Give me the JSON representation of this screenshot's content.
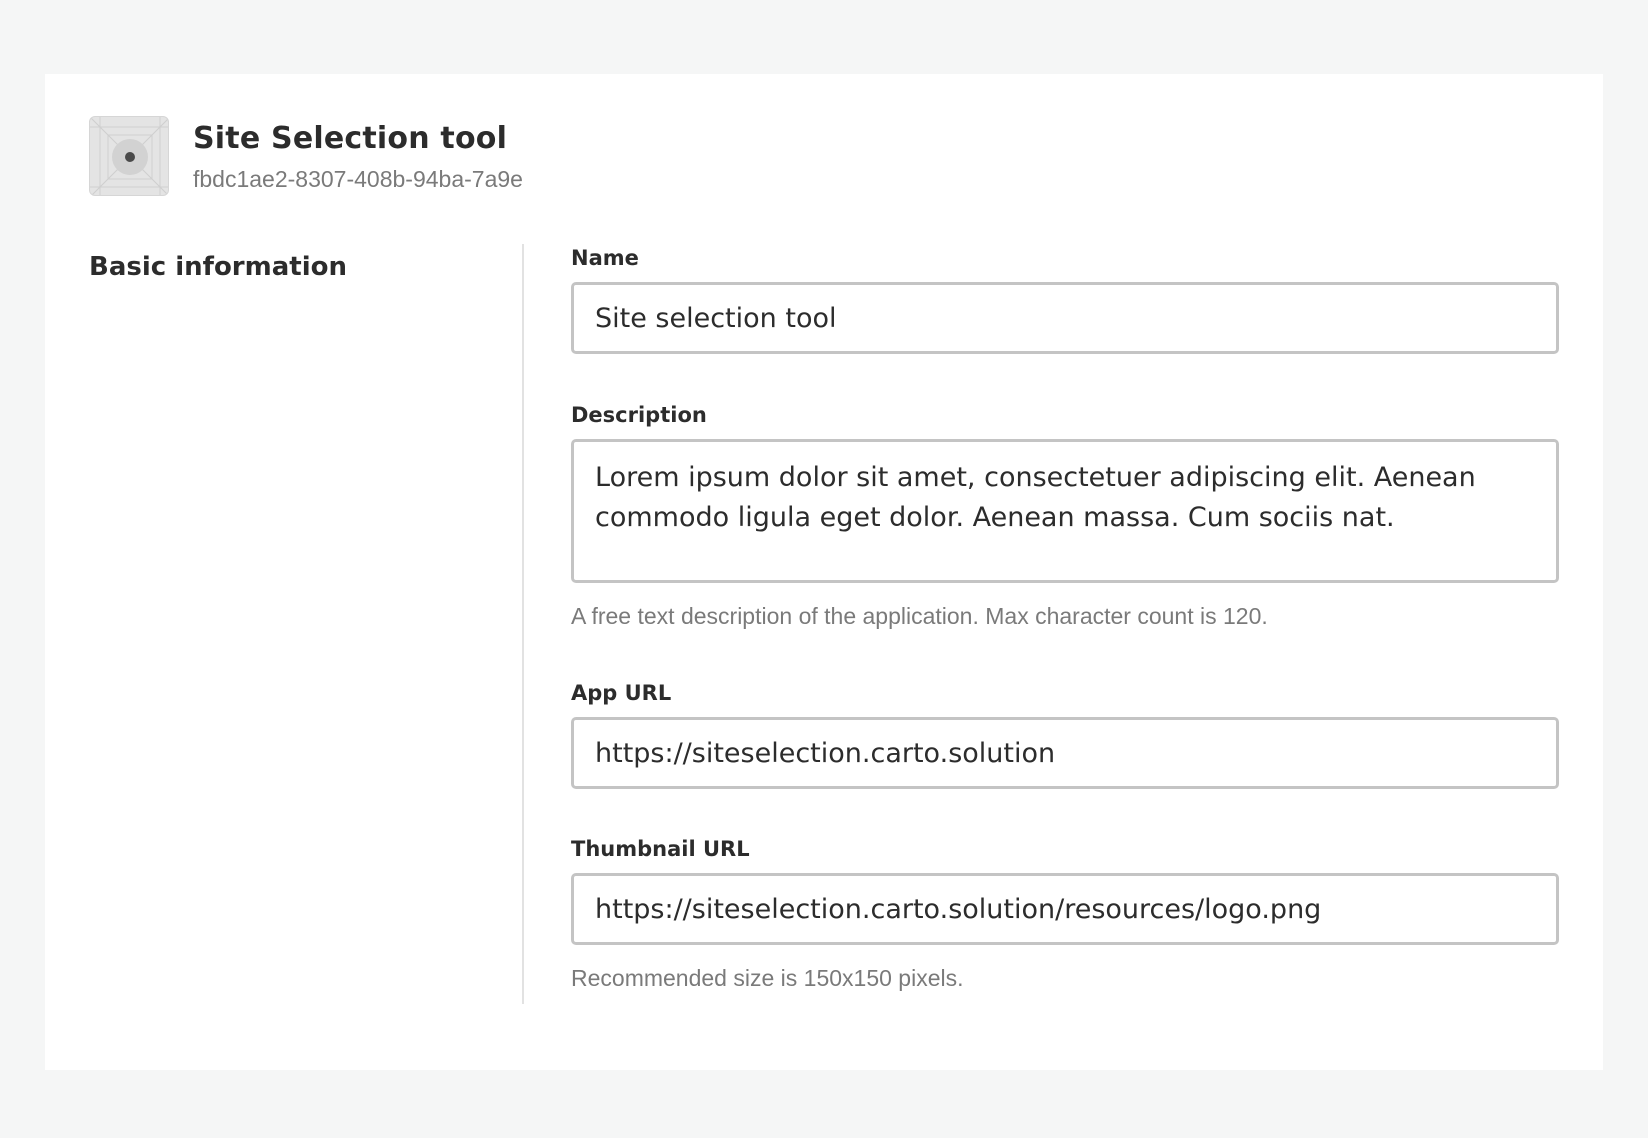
{
  "app": {
    "title": "Site Selection tool",
    "id": "fbdc1ae2-8307-408b-94ba-7a9e",
    "thumbnail_icon": "placeholder-image-icon"
  },
  "section": {
    "title": "Basic information"
  },
  "fields": {
    "name": {
      "label": "Name",
      "value": "Site selection tool"
    },
    "description": {
      "label": "Description",
      "value": "Lorem ipsum dolor sit amet, consectetuer adipiscing elit. Aenean commodo ligula eget dolor. Aenean massa. Cum sociis nat.",
      "helper": "A free text description of the application. Max character count is 120."
    },
    "app_url": {
      "label": "App URL",
      "value": "https://siteselection.carto.solution"
    },
    "thumbnail_url": {
      "label": "Thumbnail URL",
      "value": "https://siteselection.carto.solution/resources/logo.png",
      "helper": "Recommended size is 150x150 pixels."
    }
  },
  "colors": {
    "page_background": "#f5f6f6",
    "card_background": "#ffffff",
    "input_border": "#c4c4c4",
    "text_primary": "#2c2c2c",
    "text_secondary": "#7a7a7a"
  }
}
